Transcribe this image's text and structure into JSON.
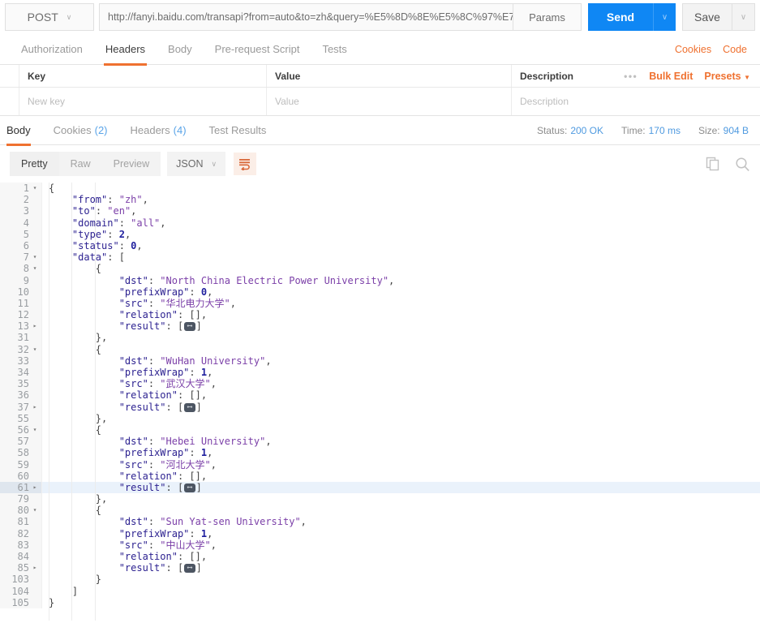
{
  "request": {
    "method": "POST",
    "url": "http://fanyi.baidu.com/transapi?from=auto&to=zh&query=%E5%8D%8E%E5%8C%97%E7...",
    "params_label": "Params",
    "send_label": "Send",
    "save_label": "Save",
    "caret": "∨",
    "send_color": "#0f87f4"
  },
  "request_tabs": {
    "items": [
      {
        "label": "Authorization"
      },
      {
        "label": "Headers"
      },
      {
        "label": "Body"
      },
      {
        "label": "Pre-request Script"
      },
      {
        "label": "Tests"
      }
    ],
    "active_index": 1,
    "cookies_link": "Cookies",
    "code_link": "Code",
    "accent": "#ef7130"
  },
  "headers_table": {
    "columns": [
      "Key",
      "Value",
      "Description"
    ],
    "dots": "•••",
    "bulk_edit": "Bulk Edit",
    "presets": "Presets",
    "presets_caret": "▼",
    "new_row": {
      "key_placeholder": "New key",
      "value_placeholder": "Value",
      "desc_placeholder": "Description"
    }
  },
  "response_tabs": {
    "items": [
      {
        "label": "Body",
        "count": ""
      },
      {
        "label": "Cookies",
        "count": "(2)"
      },
      {
        "label": "Headers",
        "count": "(4)"
      },
      {
        "label": "Test Results",
        "count": ""
      }
    ],
    "active_index": 0
  },
  "response_meta": {
    "status_label": "Status:",
    "status_value": "200 OK",
    "time_label": "Time:",
    "time_value": "170 ms",
    "size_label": "Size:",
    "size_value": "904 B",
    "value_color": "#4f9ae0"
  },
  "body_toolbar": {
    "views": [
      "Pretty",
      "Raw",
      "Preview"
    ],
    "active_view": 0,
    "format": "JSON",
    "format_caret": "∨",
    "wrap_icon": "word-wrap-icon",
    "copy_icon": "copy-icon",
    "search_icon": "search-icon"
  },
  "code": {
    "active_line": 61,
    "fold_badge": "⟷",
    "lines": [
      {
        "num": 1,
        "fold": "open",
        "indent": 0,
        "tokens": [
          {
            "t": "p",
            "v": "{"
          }
        ]
      },
      {
        "num": 2,
        "fold": "",
        "indent": 1,
        "tokens": [
          {
            "t": "k",
            "v": "\"from\""
          },
          {
            "t": "p",
            "v": ": "
          },
          {
            "t": "s",
            "v": "\"zh\""
          },
          {
            "t": "p",
            "v": ","
          }
        ]
      },
      {
        "num": 3,
        "fold": "",
        "indent": 1,
        "tokens": [
          {
            "t": "k",
            "v": "\"to\""
          },
          {
            "t": "p",
            "v": ": "
          },
          {
            "t": "s",
            "v": "\"en\""
          },
          {
            "t": "p",
            "v": ","
          }
        ]
      },
      {
        "num": 4,
        "fold": "",
        "indent": 1,
        "tokens": [
          {
            "t": "k",
            "v": "\"domain\""
          },
          {
            "t": "p",
            "v": ": "
          },
          {
            "t": "s",
            "v": "\"all\""
          },
          {
            "t": "p",
            "v": ","
          }
        ]
      },
      {
        "num": 5,
        "fold": "",
        "indent": 1,
        "tokens": [
          {
            "t": "k",
            "v": "\"type\""
          },
          {
            "t": "p",
            "v": ": "
          },
          {
            "t": "n",
            "v": "2"
          },
          {
            "t": "p",
            "v": ","
          }
        ]
      },
      {
        "num": 6,
        "fold": "",
        "indent": 1,
        "tokens": [
          {
            "t": "k",
            "v": "\"status\""
          },
          {
            "t": "p",
            "v": ": "
          },
          {
            "t": "n",
            "v": "0"
          },
          {
            "t": "p",
            "v": ","
          }
        ]
      },
      {
        "num": 7,
        "fold": "open",
        "indent": 1,
        "tokens": [
          {
            "t": "k",
            "v": "\"data\""
          },
          {
            "t": "p",
            "v": ": ["
          }
        ]
      },
      {
        "num": 8,
        "fold": "open",
        "indent": 2,
        "tokens": [
          {
            "t": "p",
            "v": "{"
          }
        ]
      },
      {
        "num": 9,
        "fold": "",
        "indent": 3,
        "tokens": [
          {
            "t": "k",
            "v": "\"dst\""
          },
          {
            "t": "p",
            "v": ": "
          },
          {
            "t": "s",
            "v": "\"North China Electric Power University\""
          },
          {
            "t": "p",
            "v": ","
          }
        ]
      },
      {
        "num": 10,
        "fold": "",
        "indent": 3,
        "tokens": [
          {
            "t": "k",
            "v": "\"prefixWrap\""
          },
          {
            "t": "p",
            "v": ": "
          },
          {
            "t": "n",
            "v": "0"
          },
          {
            "t": "p",
            "v": ","
          }
        ]
      },
      {
        "num": 11,
        "fold": "",
        "indent": 3,
        "tokens": [
          {
            "t": "k",
            "v": "\"src\""
          },
          {
            "t": "p",
            "v": ": "
          },
          {
            "t": "s",
            "v": "\"华北电力大学\""
          },
          {
            "t": "p",
            "v": ","
          }
        ]
      },
      {
        "num": 12,
        "fold": "",
        "indent": 3,
        "tokens": [
          {
            "t": "k",
            "v": "\"relation\""
          },
          {
            "t": "p",
            "v": ": [],"
          }
        ]
      },
      {
        "num": 13,
        "fold": "closed",
        "indent": 3,
        "tokens": [
          {
            "t": "k",
            "v": "\"result\""
          },
          {
            "t": "p",
            "v": ": ["
          },
          {
            "t": "badge",
            "v": ""
          },
          {
            "t": "p",
            "v": "]"
          }
        ]
      },
      {
        "num": 31,
        "fold": "",
        "indent": 2,
        "tokens": [
          {
            "t": "p",
            "v": "},"
          }
        ]
      },
      {
        "num": 32,
        "fold": "open",
        "indent": 2,
        "tokens": [
          {
            "t": "p",
            "v": "{"
          }
        ]
      },
      {
        "num": 33,
        "fold": "",
        "indent": 3,
        "tokens": [
          {
            "t": "k",
            "v": "\"dst\""
          },
          {
            "t": "p",
            "v": ": "
          },
          {
            "t": "s",
            "v": "\"WuHan University\""
          },
          {
            "t": "p",
            "v": ","
          }
        ]
      },
      {
        "num": 34,
        "fold": "",
        "indent": 3,
        "tokens": [
          {
            "t": "k",
            "v": "\"prefixWrap\""
          },
          {
            "t": "p",
            "v": ": "
          },
          {
            "t": "n",
            "v": "1"
          },
          {
            "t": "p",
            "v": ","
          }
        ]
      },
      {
        "num": 35,
        "fold": "",
        "indent": 3,
        "tokens": [
          {
            "t": "k",
            "v": "\"src\""
          },
          {
            "t": "p",
            "v": ": "
          },
          {
            "t": "s",
            "v": "\"武汉大学\""
          },
          {
            "t": "p",
            "v": ","
          }
        ]
      },
      {
        "num": 36,
        "fold": "",
        "indent": 3,
        "tokens": [
          {
            "t": "k",
            "v": "\"relation\""
          },
          {
            "t": "p",
            "v": ": [],"
          }
        ]
      },
      {
        "num": 37,
        "fold": "closed",
        "indent": 3,
        "tokens": [
          {
            "t": "k",
            "v": "\"result\""
          },
          {
            "t": "p",
            "v": ": ["
          },
          {
            "t": "badge",
            "v": ""
          },
          {
            "t": "p",
            "v": "]"
          }
        ]
      },
      {
        "num": 55,
        "fold": "",
        "indent": 2,
        "tokens": [
          {
            "t": "p",
            "v": "},"
          }
        ]
      },
      {
        "num": 56,
        "fold": "open",
        "indent": 2,
        "tokens": [
          {
            "t": "p",
            "v": "{"
          }
        ]
      },
      {
        "num": 57,
        "fold": "",
        "indent": 3,
        "tokens": [
          {
            "t": "k",
            "v": "\"dst\""
          },
          {
            "t": "p",
            "v": ": "
          },
          {
            "t": "s",
            "v": "\"Hebei University\""
          },
          {
            "t": "p",
            "v": ","
          }
        ]
      },
      {
        "num": 58,
        "fold": "",
        "indent": 3,
        "tokens": [
          {
            "t": "k",
            "v": "\"prefixWrap\""
          },
          {
            "t": "p",
            "v": ": "
          },
          {
            "t": "n",
            "v": "1"
          },
          {
            "t": "p",
            "v": ","
          }
        ]
      },
      {
        "num": 59,
        "fold": "",
        "indent": 3,
        "tokens": [
          {
            "t": "k",
            "v": "\"src\""
          },
          {
            "t": "p",
            "v": ": "
          },
          {
            "t": "s",
            "v": "\"河北大学\""
          },
          {
            "t": "p",
            "v": ","
          }
        ]
      },
      {
        "num": 60,
        "fold": "",
        "indent": 3,
        "tokens": [
          {
            "t": "k",
            "v": "\"relation\""
          },
          {
            "t": "p",
            "v": ": [],"
          }
        ]
      },
      {
        "num": 61,
        "fold": "closed",
        "indent": 3,
        "tokens": [
          {
            "t": "k",
            "v": "\"result\""
          },
          {
            "t": "p",
            "v": ": ["
          },
          {
            "t": "badge",
            "v": ""
          },
          {
            "t": "p",
            "v": "]"
          }
        ]
      },
      {
        "num": 79,
        "fold": "",
        "indent": 2,
        "tokens": [
          {
            "t": "p",
            "v": "},"
          }
        ]
      },
      {
        "num": 80,
        "fold": "open",
        "indent": 2,
        "tokens": [
          {
            "t": "p",
            "v": "{"
          }
        ]
      },
      {
        "num": 81,
        "fold": "",
        "indent": 3,
        "tokens": [
          {
            "t": "k",
            "v": "\"dst\""
          },
          {
            "t": "p",
            "v": ": "
          },
          {
            "t": "s",
            "v": "\"Sun Yat-sen University\""
          },
          {
            "t": "p",
            "v": ","
          }
        ]
      },
      {
        "num": 82,
        "fold": "",
        "indent": 3,
        "tokens": [
          {
            "t": "k",
            "v": "\"prefixWrap\""
          },
          {
            "t": "p",
            "v": ": "
          },
          {
            "t": "n",
            "v": "1"
          },
          {
            "t": "p",
            "v": ","
          }
        ]
      },
      {
        "num": 83,
        "fold": "",
        "indent": 3,
        "tokens": [
          {
            "t": "k",
            "v": "\"src\""
          },
          {
            "t": "p",
            "v": ": "
          },
          {
            "t": "s",
            "v": "\"中山大学\""
          },
          {
            "t": "p",
            "v": ","
          }
        ]
      },
      {
        "num": 84,
        "fold": "",
        "indent": 3,
        "tokens": [
          {
            "t": "k",
            "v": "\"relation\""
          },
          {
            "t": "p",
            "v": ": [],"
          }
        ]
      },
      {
        "num": 85,
        "fold": "closed",
        "indent": 3,
        "tokens": [
          {
            "t": "k",
            "v": "\"result\""
          },
          {
            "t": "p",
            "v": ": ["
          },
          {
            "t": "badge",
            "v": ""
          },
          {
            "t": "p",
            "v": "]"
          }
        ]
      },
      {
        "num": 103,
        "fold": "",
        "indent": 2,
        "tokens": [
          {
            "t": "p",
            "v": "}"
          }
        ]
      },
      {
        "num": 104,
        "fold": "",
        "indent": 1,
        "tokens": [
          {
            "t": "p",
            "v": "]"
          }
        ]
      },
      {
        "num": 105,
        "fold": "",
        "indent": 0,
        "tokens": [
          {
            "t": "p",
            "v": "}"
          }
        ]
      }
    ]
  }
}
